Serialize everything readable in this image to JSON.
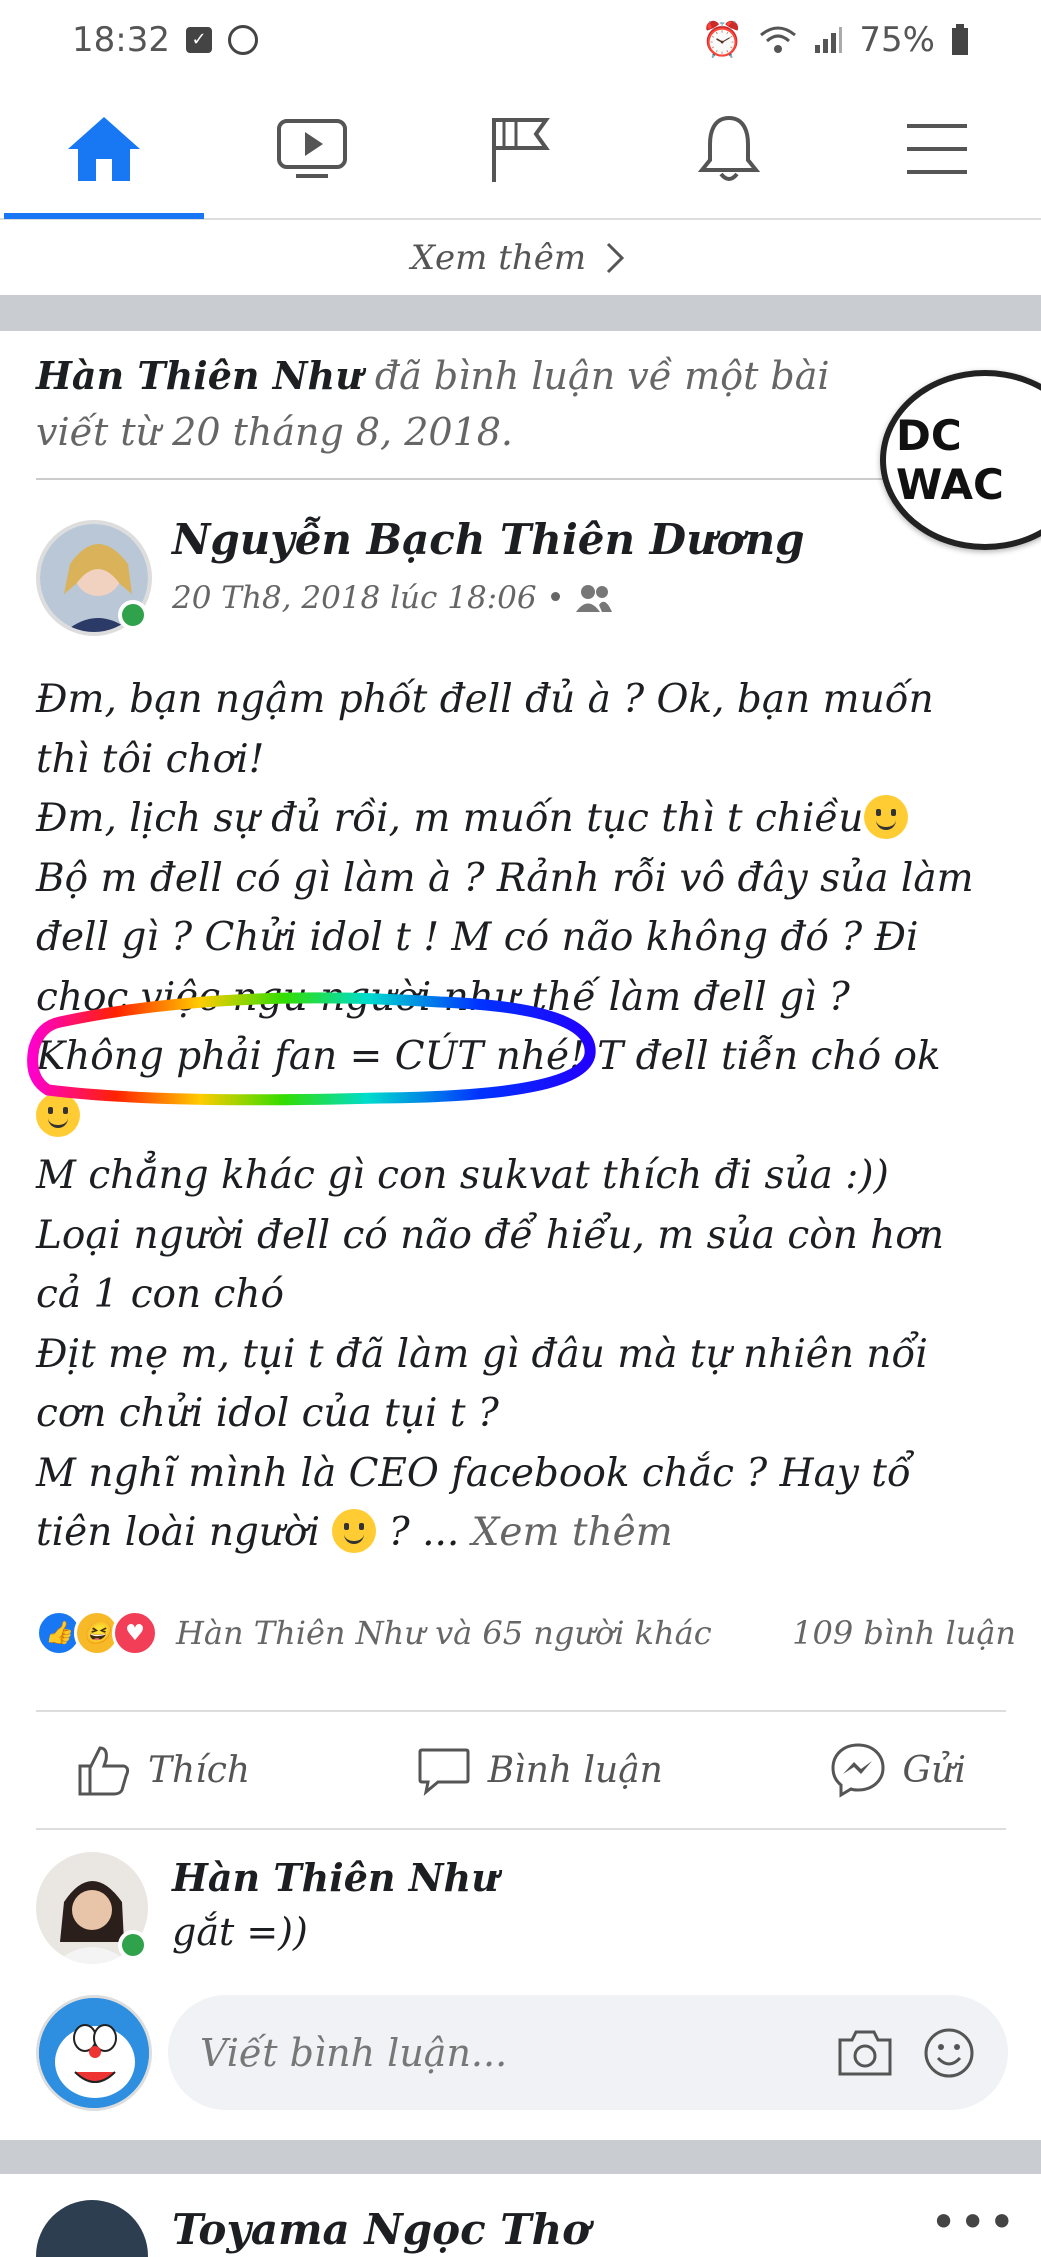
{
  "status_bar": {
    "time": "18:32",
    "battery": "75%"
  },
  "nav": {
    "items": [
      {
        "name": "home-icon",
        "active": true
      },
      {
        "name": "watch-icon",
        "active": false
      },
      {
        "name": "pages-flag-icon",
        "active": false
      },
      {
        "name": "notifications-bell-icon",
        "active": false
      },
      {
        "name": "menu-icon",
        "active": false
      }
    ]
  },
  "top_see_more": "Xem thêm",
  "activity": {
    "actor": "Hàn Thiên Như",
    "text": "đã bình luận về một bài viết từ 20 tháng 8, 2018."
  },
  "badge_text": "DC WAC",
  "post": {
    "author": "Nguyễn Bạch Thiên Dương",
    "meta": "20 Th8, 2018 lúc 18:06 •",
    "lines": [
      "Đm, bạn ngậm phốt đell đủ à ? Ok, bạn muốn",
      "thì tôi chơi!",
      "Đm, lịch sự đủ rồi, m muốn tục thì t chiều",
      "Bộ m đell có gì làm à ? Rảnh rỗi vô đây sủa làm",
      "đell gì  ? Chửi idol t ! M có não không đó ? Đi",
      "chọc việc ngu người như thế làm đell gì ?",
      "Không phải fan = CÚT nhé! T đell tiễn chó ok",
      "",
      "M chẳng khác gì con sukvat thích đi sủa :))",
      "Loại người đell có não để hiểu, m sủa còn hơn",
      "cả 1 con chó",
      "Địt mẹ m, tụi t đã làm gì đâu mà tự nhiên nổi",
      "cơn chửi idol của tụi t ?",
      "M nghĩ mình là CEO facebook chắc ? Hay tổ",
      "tiên loài người"
    ],
    "last_suffix": " ? ... ",
    "see_more": "Xem thêm",
    "reactions_text": "Hàn Thiên Như và 65 người khác",
    "comments_count": "109 bình luận"
  },
  "actions": {
    "like": "Thích",
    "comment": "Bình luận",
    "share": "Gửi"
  },
  "comment": {
    "author": "Hàn Thiên Như",
    "text": "gắt =))"
  },
  "composer": {
    "placeholder": "Viết bình luận..."
  },
  "next_post": {
    "author": "Toyama Ngọc Thơ",
    "more": "•••"
  },
  "colors": {
    "accent": "#1877f2",
    "online": "#31a24c"
  }
}
